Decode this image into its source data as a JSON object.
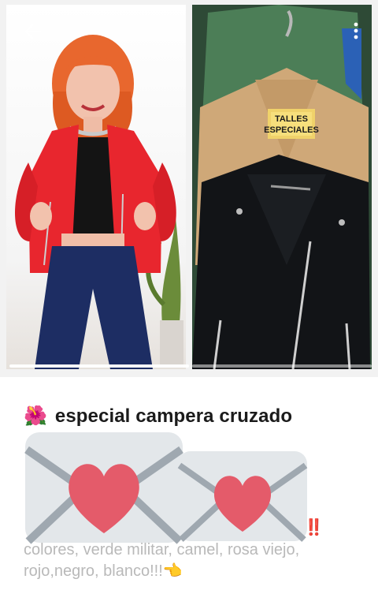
{
  "header": {
    "back_icon": "arrow-left-icon",
    "more_icon": "more-vertical-icon"
  },
  "media": {
    "images": [
      {
        "description_icon": "photo-woman-red-jacket"
      },
      {
        "description_icon": "photo-jackets-on-hangers",
        "hanger_tag": "TALLES ESPECIALES"
      }
    ],
    "page_count": 2,
    "current_page": 1
  },
  "post": {
    "title_emoji": "🌺",
    "title": "especial campera cruzado",
    "description": "colores, verde militar, camel, rosa viejo, rojo,negro, blanco!!!👈",
    "exclamation": "‼️",
    "sticker_icon": "love-letter-envelope-icon"
  },
  "colors": {
    "title_text": "#1b1b1b",
    "desc_text": "#b9b9b9",
    "heart": "#e45b6a",
    "envelope": "#e3e7ea"
  }
}
